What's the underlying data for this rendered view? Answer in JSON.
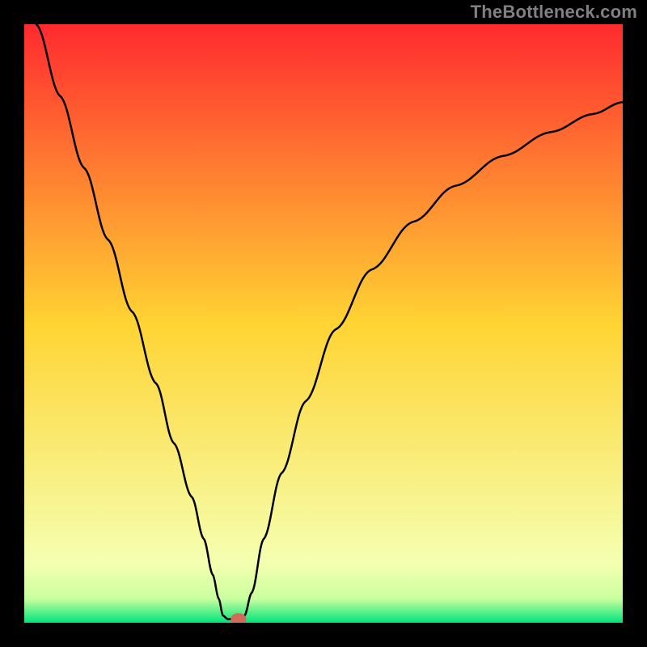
{
  "attribution": "TheBottleneck.com",
  "chart_data": {
    "type": "line",
    "title": "",
    "xlabel": "",
    "ylabel": "",
    "xlim": [
      0,
      100
    ],
    "ylim": [
      0,
      100
    ],
    "background_gradient": {
      "stops": [
        {
          "offset": 0,
          "color": "#ff2a2f"
        },
        {
          "offset": 50,
          "color": "#ffd433"
        },
        {
          "offset": 90,
          "color": "#f5ffb0"
        },
        {
          "offset": 96,
          "color": "#c9ff9e"
        },
        {
          "offset": 100,
          "color": "#00e37a"
        }
      ]
    },
    "series": [
      {
        "name": "bottleneck-curve",
        "type": "line",
        "color": "#000000",
        "points": [
          [
            2,
            100
          ],
          [
            6,
            88
          ],
          [
            10,
            76
          ],
          [
            14,
            64
          ],
          [
            18,
            52
          ],
          [
            22,
            40
          ],
          [
            25,
            30
          ],
          [
            28,
            21
          ],
          [
            30,
            14
          ],
          [
            31.5,
            8
          ],
          [
            32.5,
            4
          ],
          [
            33.2,
            1.2
          ],
          [
            34,
            0.6
          ],
          [
            35.2,
            0.6
          ],
          [
            36,
            0.6
          ],
          [
            36.8,
            1.2
          ],
          [
            38,
            5
          ],
          [
            40,
            14
          ],
          [
            43,
            25
          ],
          [
            47,
            37
          ],
          [
            52,
            49
          ],
          [
            58,
            59
          ],
          [
            65,
            67
          ],
          [
            72,
            73
          ],
          [
            80,
            78
          ],
          [
            88,
            82
          ],
          [
            95,
            85
          ],
          [
            100,
            87
          ]
        ]
      }
    ],
    "marker": {
      "x": 35.8,
      "y": 0.6,
      "rx": 1.3,
      "ry": 1.0,
      "color": "#d46a5a"
    }
  }
}
